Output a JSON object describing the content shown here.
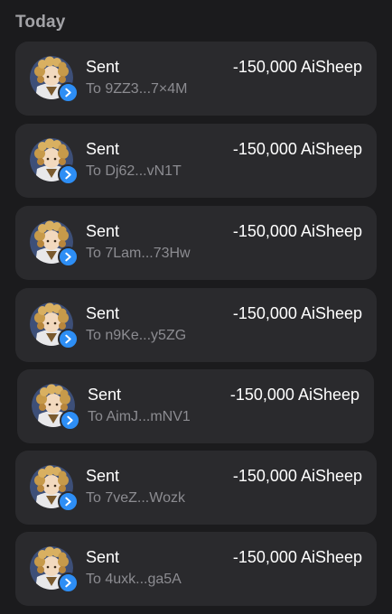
{
  "section": {
    "title": "Today"
  },
  "transactions": [
    {
      "title": "Sent",
      "subtitle": "To 9ZZ3...7×4M",
      "amount": "-150,000 AiSheep"
    },
    {
      "title": "Sent",
      "subtitle": "To Dj62...vN1T",
      "amount": "-150,000 AiSheep"
    },
    {
      "title": "Sent",
      "subtitle": "To 7Lam...73Hw",
      "amount": "-150,000 AiSheep"
    },
    {
      "title": "Sent",
      "subtitle": "To n9Ke...y5ZG",
      "amount": "-150,000 AiSheep"
    },
    {
      "title": "Sent",
      "subtitle": "To AimJ...mNV1",
      "amount": "-150,000 AiSheep"
    },
    {
      "title": "Sent",
      "subtitle": "To 7veZ...Wozk",
      "amount": "-150,000 AiSheep"
    },
    {
      "title": "Sent",
      "subtitle": "To 4uxk...ga5A",
      "amount": "-150,000 AiSheep"
    }
  ],
  "icons": {
    "avatar": "sheep-avatar-icon",
    "badge": "send-arrow-icon"
  },
  "colors": {
    "background": "#1b1b1d",
    "card": "#2a2a2d",
    "badge": "#2d8ef5",
    "muted_text": "#8c8c91"
  }
}
